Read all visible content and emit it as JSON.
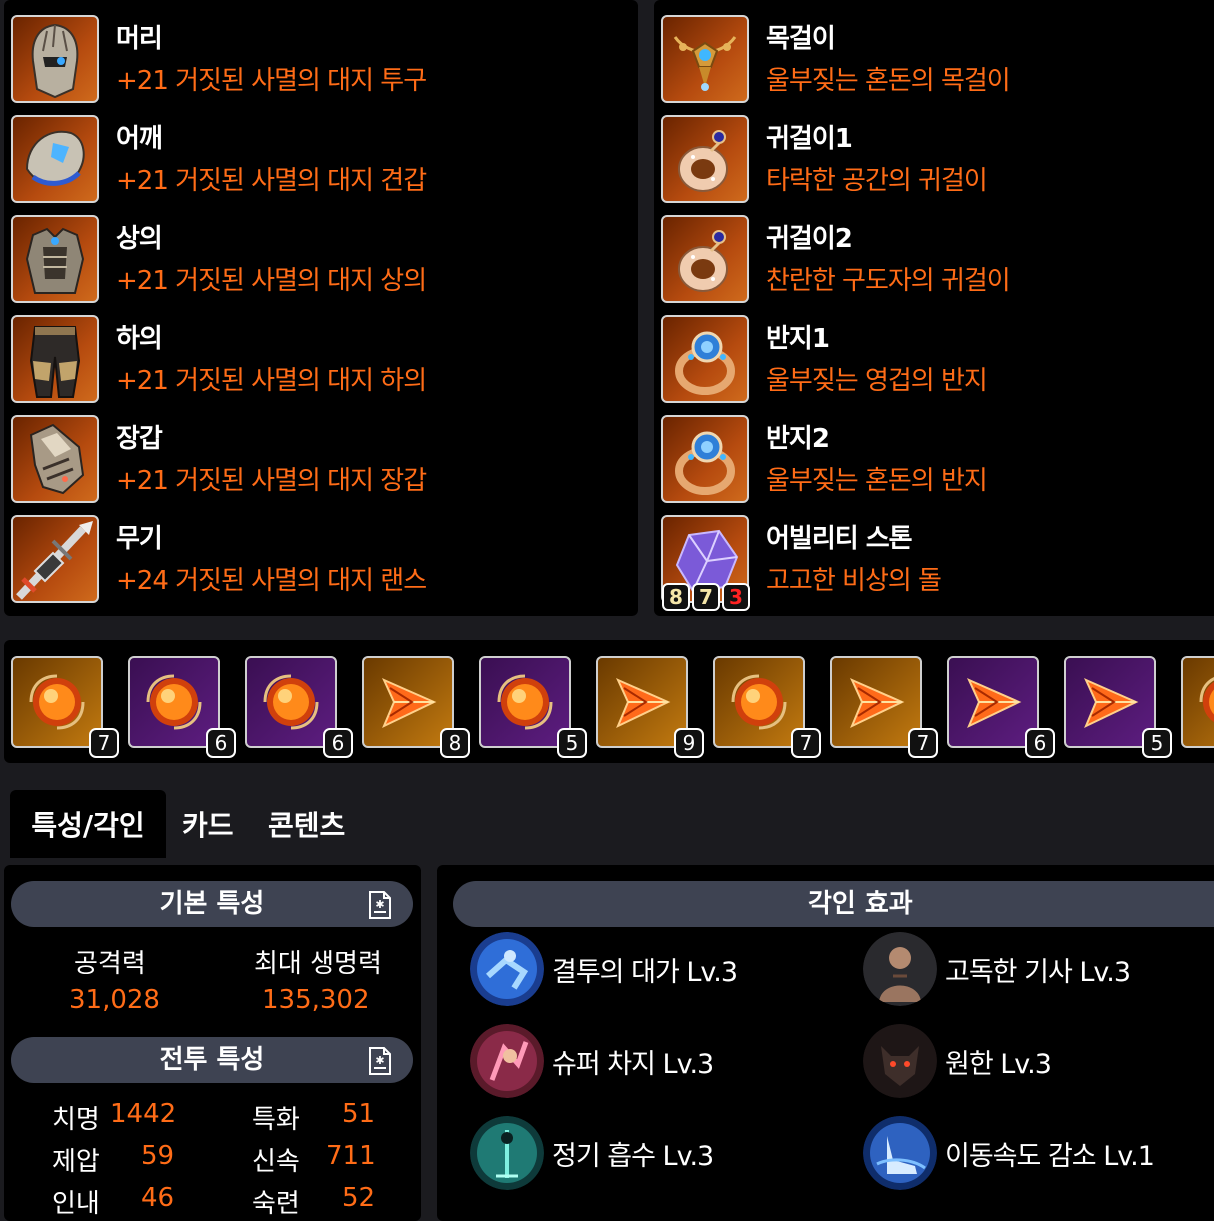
{
  "equipment_left": [
    {
      "slot": "머리",
      "name": "+21 거짓된 사멸의 대지 투구",
      "icon": "helmet-icon"
    },
    {
      "slot": "어깨",
      "name": "+21 거짓된 사멸의 대지 견갑",
      "icon": "shoulder-icon"
    },
    {
      "slot": "상의",
      "name": "+21 거짓된 사멸의 대지 상의",
      "icon": "chest-armor-icon"
    },
    {
      "slot": "하의",
      "name": "+21 거짓된 사멸의 대지 하의",
      "icon": "pants-icon"
    },
    {
      "slot": "장갑",
      "name": "+21 거짓된 사멸의 대지 장갑",
      "icon": "gloves-icon"
    },
    {
      "slot": "무기",
      "name": "+24 거짓된 사멸의 대지 랜스",
      "icon": "lance-icon"
    }
  ],
  "equipment_right": [
    {
      "slot": "목걸이",
      "name": "울부짖는 혼돈의 목걸이",
      "icon": "necklace-icon"
    },
    {
      "slot": "귀걸이1",
      "name": "타락한 공간의 귀걸이",
      "icon": "earring-icon"
    },
    {
      "slot": "귀걸이2",
      "name": "찬란한 구도자의 귀걸이",
      "icon": "earring-icon"
    },
    {
      "slot": "반지1",
      "name": "울부짖는 영겁의 반지",
      "icon": "ring-icon"
    },
    {
      "slot": "반지2",
      "name": "울부짖는 혼돈의 반지",
      "icon": "ring-icon"
    },
    {
      "slot": "어빌리티 스톤",
      "name": "고고한 비상의 돌",
      "icon": "ability-stone-icon"
    }
  ],
  "ability_stone_levels": [
    "8",
    "7",
    "3"
  ],
  "colors": {
    "item_name": "#ff6c17",
    "negative_level": "#ff2222",
    "positive_level": "#f5e6a8"
  },
  "gems": [
    {
      "level": "7",
      "type": "orb",
      "grade": "legendary"
    },
    {
      "level": "6",
      "type": "orb",
      "grade": "epic"
    },
    {
      "level": "6",
      "type": "orb",
      "grade": "epic"
    },
    {
      "level": "8",
      "type": "shard",
      "grade": "legendary"
    },
    {
      "level": "5",
      "type": "orb",
      "grade": "epic"
    },
    {
      "level": "9",
      "type": "shard",
      "grade": "legendary"
    },
    {
      "level": "7",
      "type": "orb",
      "grade": "legendary"
    },
    {
      "level": "7",
      "type": "shard",
      "grade": "legendary"
    },
    {
      "level": "6",
      "type": "shard",
      "grade": "epic"
    },
    {
      "level": "5",
      "type": "shard",
      "grade": "epic"
    },
    {
      "level": "",
      "type": "orb",
      "grade": "legendary"
    }
  ],
  "tabs": [
    "특성/각인",
    "카드",
    "콘텐츠"
  ],
  "basic_stats": {
    "title": "기본 특성",
    "attack_label": "공격력",
    "attack_value": "31,028",
    "hp_label": "최대 생명력",
    "hp_value": "135,302"
  },
  "combat_stats": {
    "title": "전투 특성",
    "items": [
      {
        "label": "치명",
        "value": "1442"
      },
      {
        "label": "특화",
        "value": "51"
      },
      {
        "label": "제압",
        "value": "59"
      },
      {
        "label": "신속",
        "value": "711"
      },
      {
        "label": "인내",
        "value": "46"
      },
      {
        "label": "숙련",
        "value": "52"
      }
    ]
  },
  "engravings": {
    "title": "각인 효과",
    "items": [
      {
        "name": "결투의 대가 Lv.3",
        "icon": "duel-master-icon"
      },
      {
        "name": "고독한 기사 Lv.3",
        "icon": "lone-knight-icon"
      },
      {
        "name": "슈퍼 차지 Lv.3",
        "icon": "super-charge-icon"
      },
      {
        "name": "원한 Lv.3",
        "icon": "grudge-icon"
      },
      {
        "name": "정기 흡수 Lv.3",
        "icon": "spirit-absorption-icon"
      },
      {
        "name": "이동속도 감소 Lv.1",
        "icon": "move-speed-reduction-icon"
      }
    ]
  }
}
